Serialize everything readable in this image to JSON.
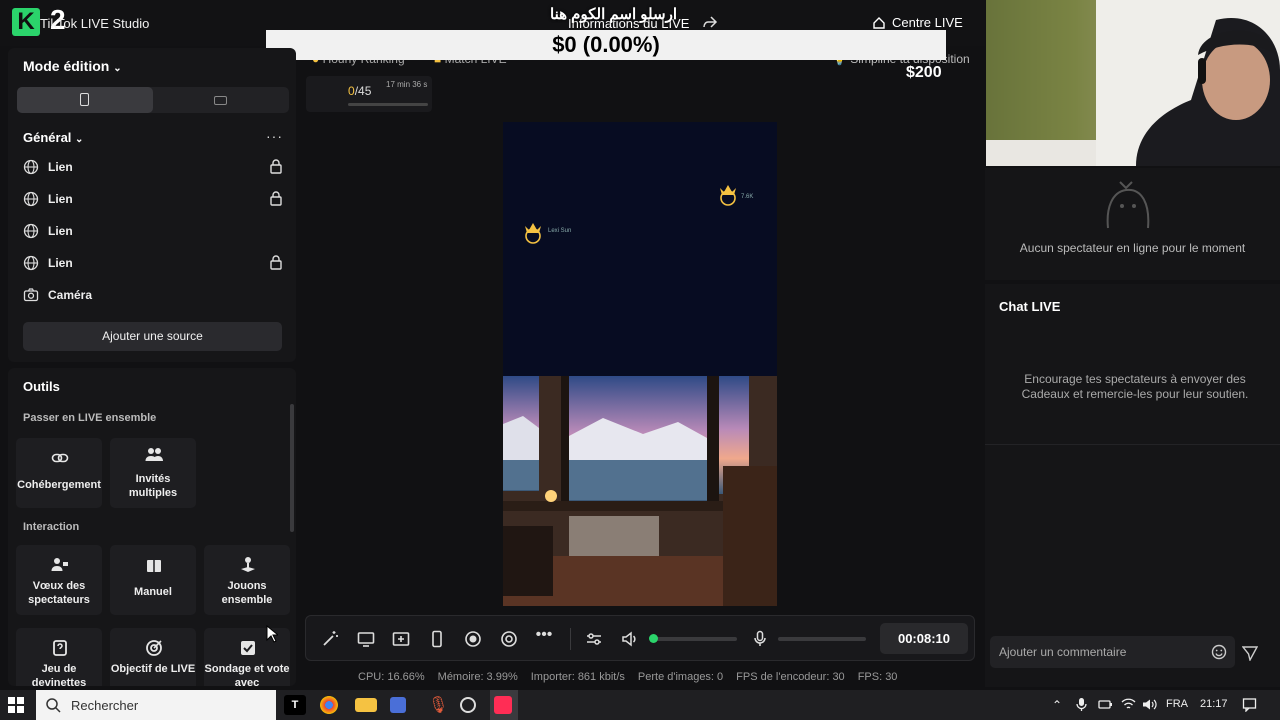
{
  "topbar": {
    "logo_letter": "K",
    "logo_num": "2",
    "app_title": "TikTok LIVE Studio",
    "live_info": "Informations du LIVE",
    "arabic_overlay": "ارسلو اسم الكوم هنا",
    "live_center": "Centre LIVE"
  },
  "overlay": {
    "money_banner": "$0 (0.00%)",
    "money_left": "$0",
    "money_right": "$200",
    "ranking": "Hourly Ranking",
    "match": "Match LIVE",
    "bulb": "Simpline ta disposition"
  },
  "goal": {
    "current": "0",
    "total": "/45",
    "time": "17 min 36 s"
  },
  "left_panel": {
    "mode_title": "Mode édition",
    "general_title": "Général",
    "more": "···",
    "sources": [
      {
        "label": "Lien",
        "icon": "globe-icon",
        "locked": true
      },
      {
        "label": "Lien",
        "icon": "globe-icon",
        "locked": true
      },
      {
        "label": "Lien",
        "icon": "globe-icon",
        "locked": false
      },
      {
        "label": "Lien",
        "icon": "globe-icon",
        "locked": true
      },
      {
        "label": "Caméra",
        "icon": "camera-icon",
        "locked": false
      }
    ],
    "add_source": "Ajouter une source"
  },
  "tools": {
    "title": "Outils",
    "section_together": "Passer en LIVE ensemble",
    "section_interaction": "Interaction",
    "tiles": {
      "cohost": "Cohébergement",
      "multi_guests": "Invités multiples",
      "viewer_wishes": "Vœux des spectateurs",
      "manual": "Manuel",
      "play_together": "Jouons ensemble",
      "guess_game": "Jeu de devinettes",
      "live_goal": "Objectif de LIVE",
      "poll": "Sondage et vote avec"
    }
  },
  "preview": {
    "crown_left_label": "Lexi Sun",
    "crown_right_label": "7.6K"
  },
  "controls": {
    "timer": "00:08:10",
    "volume_level": 0.0
  },
  "stats": {
    "cpu": "CPU: 16.66%",
    "memory": "Mémoire: 3.99%",
    "upload": "Importer: 861 kbit/s",
    "frame_loss": "Perte d'images: 0",
    "encoder_fps": "FPS de l'encodeur: 30",
    "fps": "FPS: 30"
  },
  "right_panel": {
    "viewers_empty": "Aucun spectateur en ligne pour le moment",
    "chat_title": "Chat LIVE",
    "chat_empty": "Encourage tes spectateurs à envoyer des Cadeaux et remercie-les pour leur soutien.",
    "comment_placeholder": "Ajouter un commentaire"
  },
  "taskbar": {
    "search": "Rechercher",
    "lang": "FRA",
    "time": "21:17"
  },
  "colors": {
    "accent_green": "#2bd46b",
    "goal_yellow": "#f5c242",
    "preview_bg": "#070c22"
  }
}
